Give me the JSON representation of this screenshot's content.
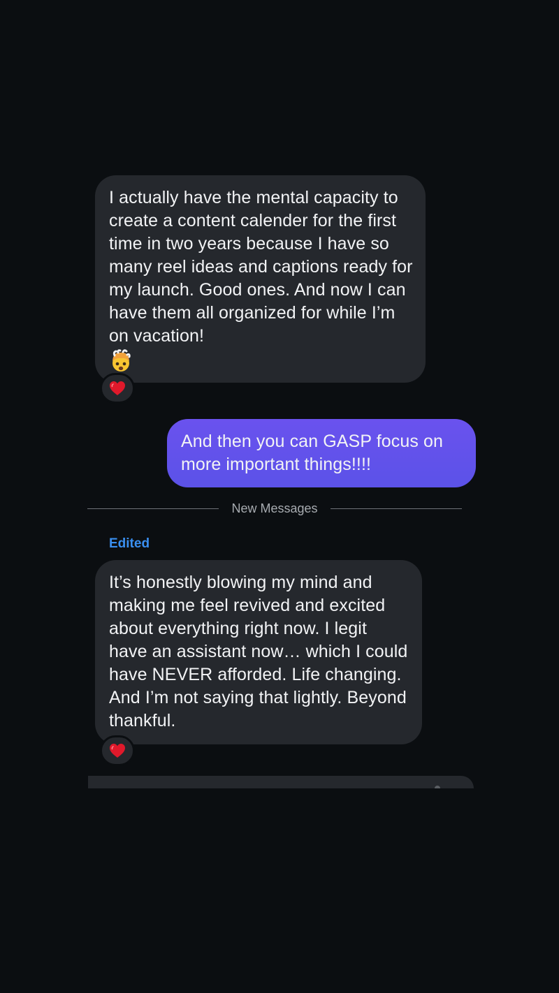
{
  "messages": [
    {
      "direction": "incoming",
      "text": "I actually have the mental capacity to create a content calender for the first time in two years because I have so many  reel ideas and captions ready for my launch. Good ones. And now I can have them all organized for while I’m on vacation!",
      "trailing_emoji": "exploding-head-emoji",
      "reaction": "heart-emoji"
    },
    {
      "direction": "outgoing",
      "text": "And then you can GASP focus on more important things!!!!"
    },
    {
      "direction": "incoming",
      "status_label": "Edited",
      "text": "It’s honestly blowing my mind and making me feel revived and excited about everything right now. I legit have an assistant now… which I could have NEVER afforded. Life changing. And I’m not saying that lightly. Beyond thankful.",
      "reaction": "heart-emoji"
    }
  ],
  "divider": {
    "label": "New Messages"
  },
  "colors": {
    "background": "#0b0e11",
    "incoming_bubble": "#25282d",
    "outgoing_bubble": "#6152ec",
    "edited_label": "#3a8ff0",
    "reaction_heart": "#e0192b"
  }
}
